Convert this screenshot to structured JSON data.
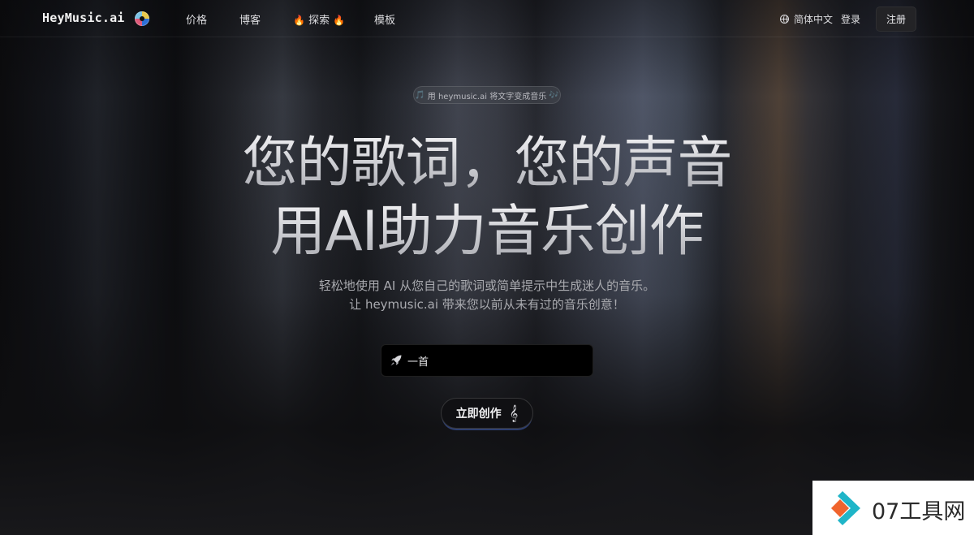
{
  "header": {
    "logo_text": "HeyMusic.ai",
    "nav": {
      "pricing": "价格",
      "blog": "博客",
      "explore": "探索",
      "templates": "模板"
    },
    "language": "简体中文",
    "login": "登录",
    "signup": "注册"
  },
  "hero": {
    "badge": "用 heymusic.ai 将文字变成音乐",
    "headline_line1": "您的歌词，您的声音",
    "headline_line2": "用AI助力音乐创作",
    "subtitle_line1": "轻松地使用 AI 从您自己的歌词或简单提示中生成迷人的音乐。",
    "subtitle_line2": "让 heymusic.ai 带来您以前从未有过的音乐创意！",
    "input_value": "一首",
    "cta_label": "立即创作"
  },
  "watermark": {
    "text": "07工具网"
  },
  "icons": {
    "logo": "music-disc-icon",
    "explore_left": "fire-icon",
    "explore_right": "fire-icon",
    "language": "globe-icon",
    "badge_left": "music-note-icon",
    "badge_right": "music-notes-icon",
    "input": "rocket-icon",
    "cta": "treble-clef-icon"
  },
  "colors": {
    "background": "#0d0d0f",
    "signup_button": "#232326",
    "input_background": "#000000",
    "cta_glow": "#4664be",
    "watermark_orange": "#f0642d",
    "watermark_teal": "#1fb5c8"
  }
}
